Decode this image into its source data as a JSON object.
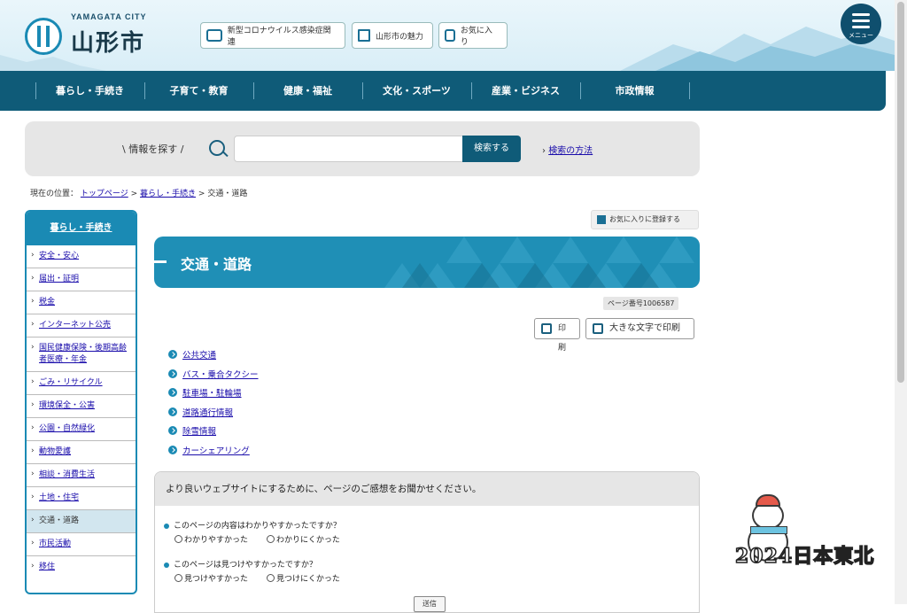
{
  "logo": {
    "city": "YAMAGATA CITY",
    "name": "山形市"
  },
  "header_buttons": [
    {
      "label": "新型コロナウイルス感染症関連",
      "icon": "mask-icon"
    },
    {
      "label": "山形市の魅力",
      "icon": "pen-icon"
    },
    {
      "label": "お気に入り",
      "icon": "bookmark-icon"
    }
  ],
  "menu": {
    "label": "メニュー"
  },
  "nav": [
    "暮らし・手続き",
    "子育て・教育",
    "健康・福祉",
    "文化・スポーツ",
    "産業・ビジネス",
    "市政情報"
  ],
  "search": {
    "label": "情報を探す",
    "placeholder": "",
    "button": "検索する",
    "help": "検索の方法"
  },
  "breadcrumb": {
    "prefix": "現在の位置：",
    "home": "トップページ",
    "sep": ">",
    "parent": "暮らし・手続き",
    "current": "交通・道路"
  },
  "sidebar": {
    "title": "暮らし・手続き",
    "items": [
      {
        "label": "安全・安心"
      },
      {
        "label": "届出・証明"
      },
      {
        "label": "税金"
      },
      {
        "label": "インターネット公売"
      },
      {
        "label": "国民健康保険・後期高齢者医療・年金"
      },
      {
        "label": "ごみ・リサイクル"
      },
      {
        "label": "環境保全・公害"
      },
      {
        "label": "公園・自然緑化"
      },
      {
        "label": "動物愛護"
      },
      {
        "label": "相談・消費生活"
      },
      {
        "label": "土地・住宅"
      },
      {
        "label": "交通・道路"
      },
      {
        "label": "市民活動"
      },
      {
        "label": "移住"
      }
    ]
  },
  "favorite_button": "お気に入りに登録する",
  "page_title": "交通・道路",
  "page_number": "ページ番号1006587",
  "print": {
    "normal": "印刷",
    "large": "大きな文字で印刷"
  },
  "links": [
    "公共交通",
    "バス・乗合タクシー",
    "駐車場・駐輪場",
    "道路通行情報",
    "除雪情報",
    "カーシェアリング"
  ],
  "survey": {
    "heading": "より良いウェブサイトにするために、ページのご感想をお聞かせください。",
    "q1": "このページの内容はわかりやすかったですか？",
    "q1_options": [
      "わかりやすかった",
      "わかりにくかった"
    ],
    "q2": "このページは見つけやすかったですか？",
    "q2_options": [
      "見つけやすかった",
      "見つけにくかった"
    ],
    "submit": "送信"
  },
  "watermark": "2024日本東北",
  "colors": {
    "primary": "#0f5b78",
    "accent": "#1a8ab4",
    "banner": "#1f8fb6"
  }
}
